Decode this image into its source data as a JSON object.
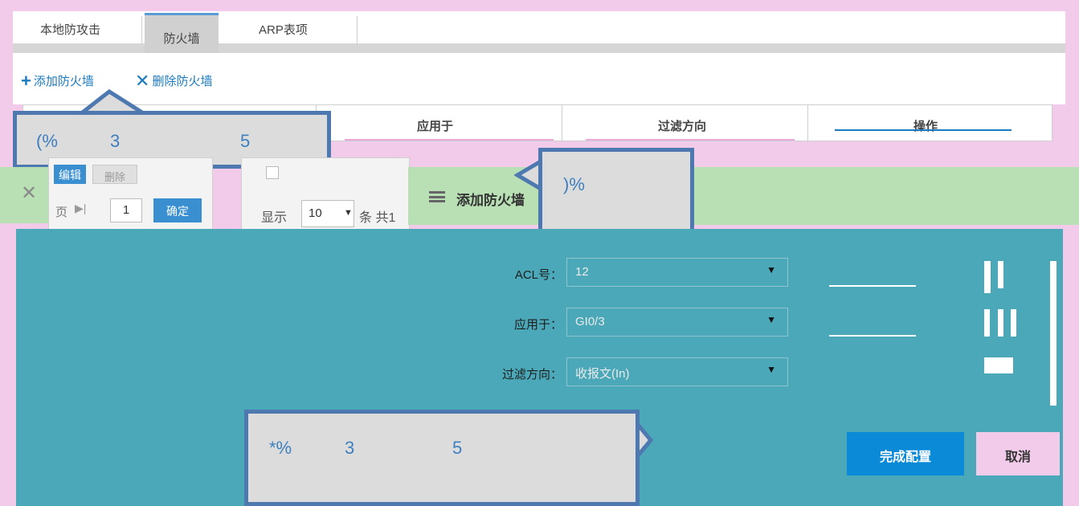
{
  "tabs": [
    {
      "label": "本地防攻击"
    },
    {
      "label": "防火墙"
    },
    {
      "label": "ARP表项"
    }
  ],
  "toolbar": {
    "add_label": "添加防火墙",
    "delete_label": "删除防火墙"
  },
  "table": {
    "headers": [
      "应用于",
      "过滤方向",
      "操作"
    ]
  },
  "callouts": {
    "top_left": [
      "(%",
      "3",
      "5"
    ],
    "top_right": ")%",
    "bottom": [
      "*%",
      "3",
      "5"
    ]
  },
  "pager": {
    "edit_label": "编辑",
    "delete_label": "删除",
    "page_label": "页",
    "page_value": "1",
    "confirm_label": "确定",
    "show_label": "显示",
    "page_size": "10",
    "total_label": "条 共1"
  },
  "dialog": {
    "title": "添加防火墙",
    "fields": [
      {
        "label": "ACL号：",
        "value": "12"
      },
      {
        "label": "应用于：",
        "value": "GI0/3"
      },
      {
        "label": "过滤方向：",
        "value": "收报文(In)"
      }
    ],
    "submit_label": "完成配置",
    "cancel_label": "取消"
  },
  "colors": {
    "accent": "#1a7ac2",
    "dialog_body": "#4ba8b9",
    "dialog_header": "#b9e0b4",
    "submit": "#0b8ad8",
    "background": "#f1cbe9"
  },
  "icons": {
    "add": "plus-icon",
    "delete": "x-icon",
    "close": "close-icon",
    "menu": "hamburger-icon",
    "dropdown": "triangle-down-icon"
  }
}
